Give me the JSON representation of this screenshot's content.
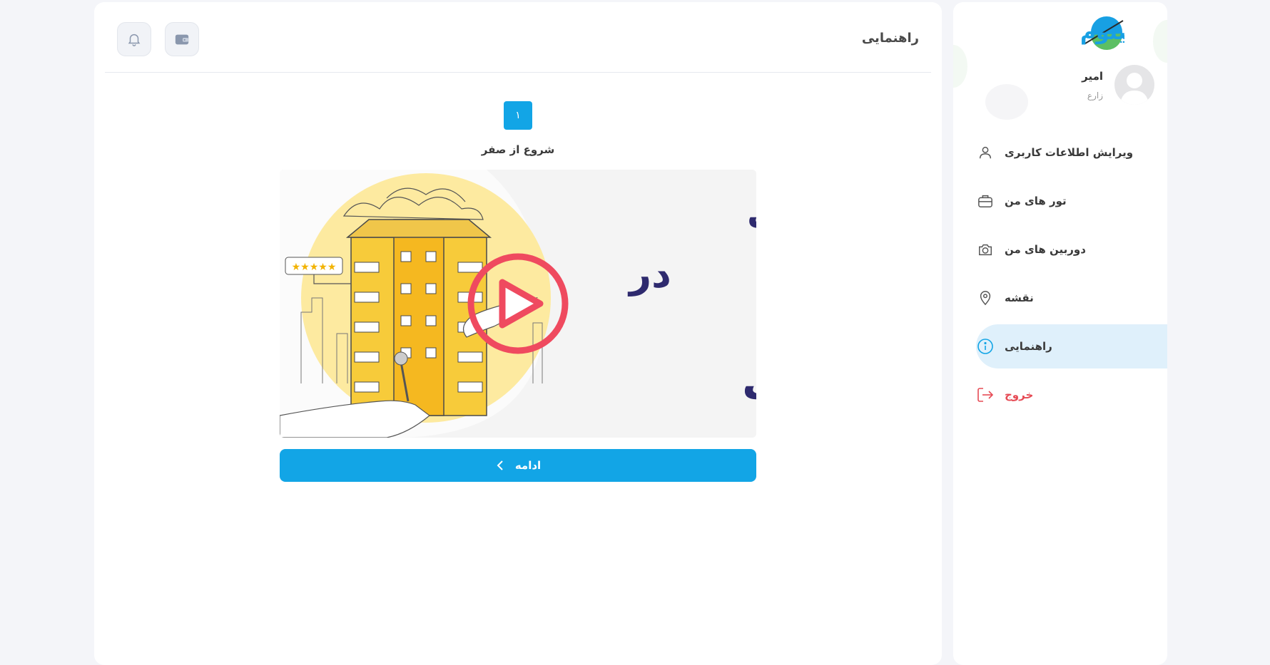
{
  "header": {
    "title": "راهنمایی",
    "buttons": [
      {
        "name": "wallet-button",
        "icon": "wallet-icon"
      },
      {
        "name": "notifications-button",
        "icon": "bell-icon"
      }
    ]
  },
  "step": {
    "number": "۱",
    "title": "شروع از صفر"
  },
  "video": {
    "line1": "تحولی بزرگ",
    "line2": "در",
    "line3": "حوزه املاک",
    "play_icon": "play-icon"
  },
  "continue_button": {
    "label": "ادامه",
    "icon": "chevron-left-icon"
  },
  "sidebar": {
    "logo_text": "اسپینوم",
    "user": {
      "name": "امیر",
      "role": "زارع"
    },
    "items": [
      {
        "label": "ویرایش اطلاعات کاربری",
        "icon": "user-icon"
      },
      {
        "label": "تور های من",
        "icon": "briefcase-icon"
      },
      {
        "label": "دوربین های من",
        "icon": "camera-icon"
      },
      {
        "label": "نقشه",
        "icon": "map-pin-icon"
      },
      {
        "label": "راهنمایی",
        "icon": "info-icon",
        "active": true
      },
      {
        "label": "خروج",
        "icon": "logout-icon"
      }
    ]
  },
  "colors": {
    "primary": "#12a5e6",
    "active_bg": "#dff0fb",
    "logout": "#e64b55",
    "play": "#ef4a5f",
    "headline": "#2e2a6e",
    "logo_blue": "#18a0e3",
    "logo_green": "#5cbf63"
  }
}
